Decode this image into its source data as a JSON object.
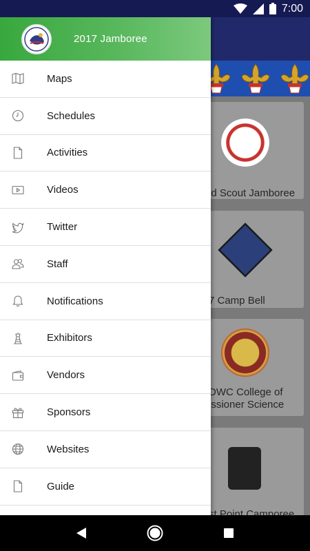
{
  "status_bar": {
    "time": "7:00"
  },
  "drawer": {
    "header_title": "2017 Jamboree",
    "menu": [
      {
        "label": "Maps",
        "icon": "map-icon"
      },
      {
        "label": "Schedules",
        "icon": "clock-icon"
      },
      {
        "label": "Activities",
        "icon": "document-icon"
      },
      {
        "label": "Videos",
        "icon": "video-icon"
      },
      {
        "label": "Twitter",
        "icon": "twitter-icon"
      },
      {
        "label": "Staff",
        "icon": "people-icon"
      },
      {
        "label": "Notifications",
        "icon": "bell-icon"
      },
      {
        "label": "Exhibitors",
        "icon": "tower-icon"
      },
      {
        "label": "Vendors",
        "icon": "wallet-icon"
      },
      {
        "label": "Sponsors",
        "icon": "gift-icon"
      },
      {
        "label": "Websites",
        "icon": "globe-icon"
      },
      {
        "label": "Guide",
        "icon": "document-icon"
      }
    ]
  },
  "background_cards": [
    {
      "title_lines": [
        "ld Scout Jamboree"
      ]
    },
    {
      "title_lines": [
        "7 Camp Bell"
      ]
    },
    {
      "title_lines": [
        "DWC College of",
        "issioner Science"
      ]
    },
    {
      "title_lines": [
        "st Point Camporee"
      ]
    }
  ],
  "colors": {
    "drawer_header": "#4caf50",
    "toolbar": "#21296a",
    "banner": "#1e4fb0"
  }
}
